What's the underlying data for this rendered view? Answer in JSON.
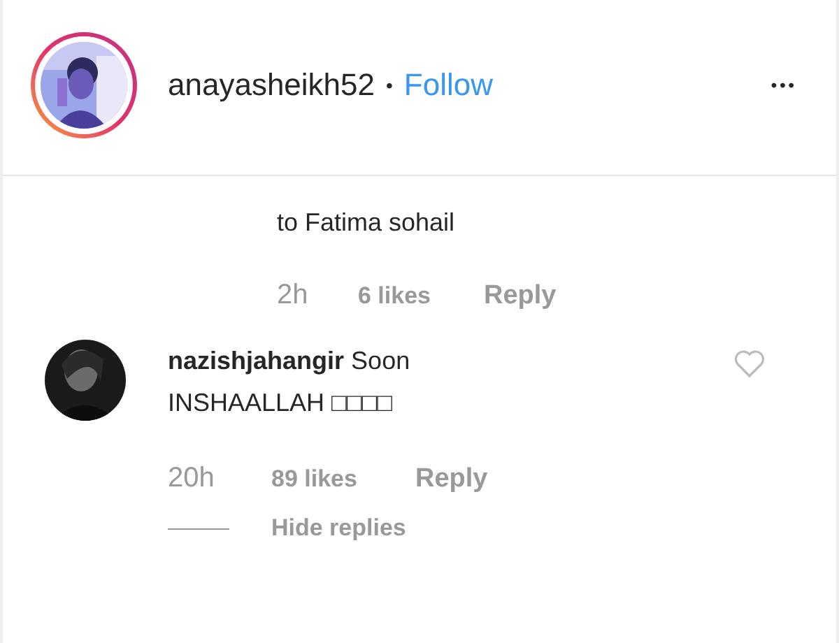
{
  "header": {
    "username": "anayasheikh52",
    "separator": "•",
    "follow": "Follow",
    "more": "•••"
  },
  "comments": [
    {
      "kind": "continued",
      "text": "to Fatima sohail",
      "time": "2h",
      "likes": "6 likes",
      "reply": "Reply"
    },
    {
      "kind": "full",
      "username": "nazishjahangir",
      "text": "Soon INSHAALLAH □□□□",
      "time": "20h",
      "likes": "89 likes",
      "reply": "Reply",
      "hide_replies": "Hide replies"
    }
  ]
}
